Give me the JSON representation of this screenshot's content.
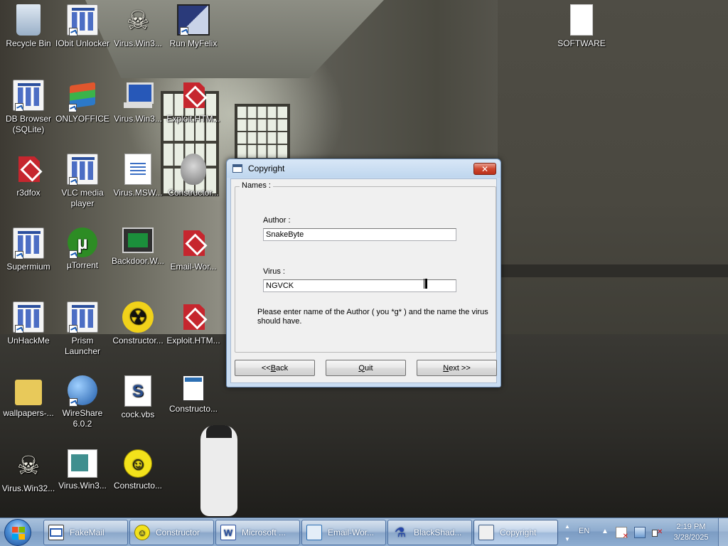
{
  "desktop": {
    "icons": {
      "recycle_bin": "Recycle Bin",
      "iobit_unlocker": "IObit Unlocker",
      "virus_win3_a": "Virus.Win3...",
      "run_myfelix": "Run MyFelix",
      "software": "SOFTWARE",
      "db_browser": "DB Browser (SQLite)",
      "onlyoffice": "ONLYOFFICE",
      "virus_win3_b": "Virus.Win3...",
      "exploit_htm_a": "Exploit.HTM...",
      "r3dfox": "r3dfox",
      "vlc": "VLC media player",
      "virus_msw": "Virus.MSW...",
      "constructor_a": "Constructor...",
      "supermium": "Supermium",
      "utorrent": "µTorrent",
      "backdoor": "Backdoor.W...",
      "email_wor": "Email-Wor...",
      "unhackme": "UnHackMe",
      "prism": "Prism Launcher",
      "constructor_b": "Constructor...",
      "exploit_htm_b": "Exploit.HTM...",
      "wallpapers": "wallpapers-...",
      "wireshare": "WireShare 6.0.2",
      "cock_vbs": "cock.vbs",
      "constructor_c": "Constructo...",
      "virus_win32": "Virus.Win32...",
      "virus_win3_c": "Virus.Win3...",
      "constructor_d": "Constructo..."
    }
  },
  "dialog": {
    "title": "Copyright",
    "close_glyph": "✕",
    "group_label": "Names :",
    "author_label": "Author :",
    "author_value": "SnakeByte",
    "virus_label": "Virus :",
    "virus_value": "NGVCK",
    "help_text": "Please enter name of the Author ( you *g* ) and the name the virus should have.",
    "buttons": {
      "back_prefix": "<< ",
      "back_key": "B",
      "back_rest": "ack",
      "quit_key": "Q",
      "quit_rest": "uit",
      "next_key": "N",
      "next_rest": "ext >>"
    }
  },
  "taskbar": {
    "items": [
      {
        "label": "FakeMail",
        "icon": "mail-icon"
      },
      {
        "label": "Constructor",
        "icon": "smiley-icon"
      },
      {
        "label": "Microsoft ...",
        "icon": "word-icon"
      },
      {
        "label": "Email-Wor...",
        "icon": "email-icon"
      },
      {
        "label": "BlackShad...",
        "icon": "flask-icon"
      },
      {
        "label": "Copyright",
        "icon": "window-icon"
      }
    ],
    "language": "EN",
    "time": "2:19 PM",
    "date": "3/28/2025"
  }
}
